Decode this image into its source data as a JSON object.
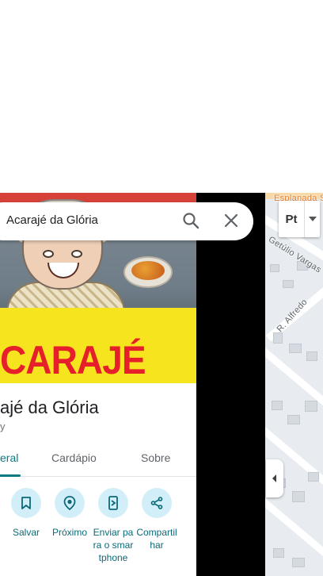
{
  "map": {
    "labels": {
      "top": "Esplanada S",
      "street_getulio": "Getúlio Vargas",
      "street_alfredo": "R. Alfredo"
    },
    "layer_button_label": "Pt"
  },
  "search": {
    "query": "Acarajé da Glória"
  },
  "place": {
    "hero_text": "CARAJÉ",
    "title": "ajé da Glória",
    "subtitle": "y"
  },
  "tabs": [
    {
      "label": "eral",
      "active": true
    },
    {
      "label": "Cardápio",
      "active": false
    },
    {
      "label": "Sobre",
      "active": false
    }
  ],
  "actions": [
    {
      "label": "Salvar",
      "icon": "bookmark-icon"
    },
    {
      "label": "Próximo",
      "icon": "nearby-icon"
    },
    {
      "label": "Enviar para o smartphone",
      "icon": "send-to-phone-icon"
    },
    {
      "label": "Compartilhar",
      "icon": "share-icon"
    }
  ],
  "colors": {
    "accent": "#0b7a84",
    "action_bg": "#d2eef8",
    "banner_yellow": "#f6e51e",
    "banner_red": "#e5202a"
  }
}
